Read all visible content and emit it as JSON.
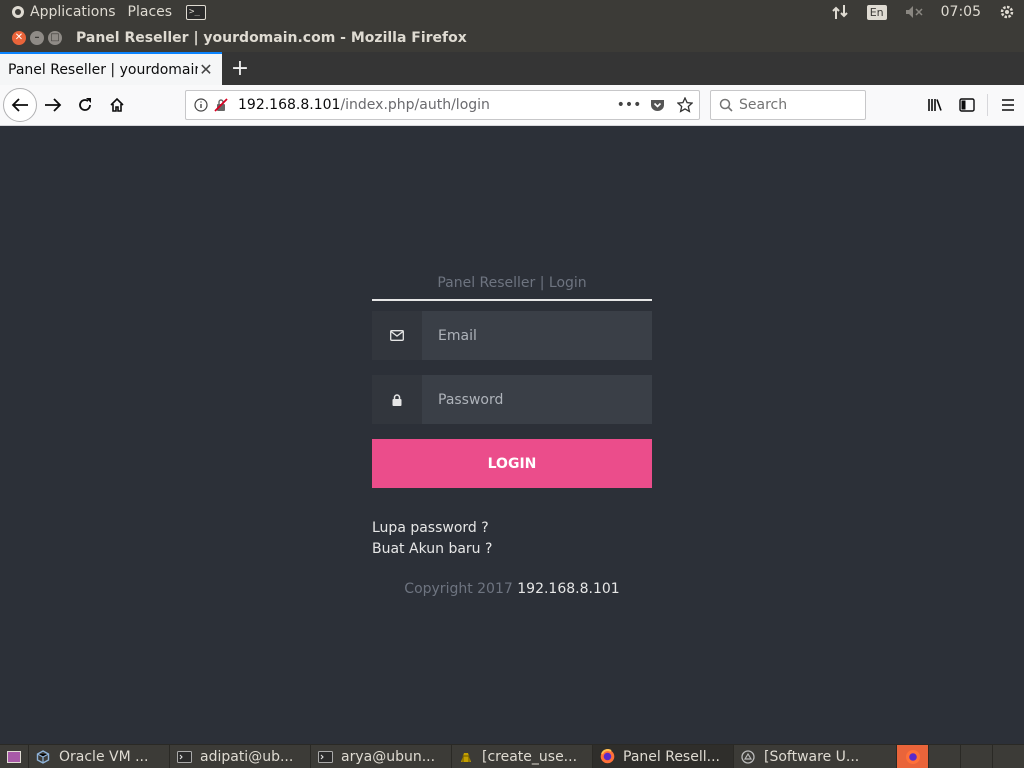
{
  "top_panel": {
    "applications_label": "Applications",
    "places_label": "Places",
    "lang": "En",
    "time": "07:05"
  },
  "window": {
    "title": "Panel Reseller | yourdomain.com - Mozilla Firefox"
  },
  "browser": {
    "tab_label": "Panel Reseller | yourdomain.com",
    "url_host": "192.168.8.101",
    "url_path": "/index.php/auth/login",
    "search_placeholder": "Search"
  },
  "login": {
    "heading": "Panel Reseller | Login",
    "email_placeholder": "Email",
    "password_placeholder": "Password",
    "login_button": "LOGIN",
    "forgot_link": "Lupa password ?",
    "register_link": "Buat Akun baru ?",
    "copyright_prefix": "Copyright 2017",
    "copyright_host": "192.168.8.101"
  },
  "taskbar": {
    "tasks": [
      {
        "label": "Oracle VM ...",
        "icon": "virtualbox-icon"
      },
      {
        "label": "adipati@ub...",
        "icon": "terminal-icon"
      },
      {
        "label": "arya@ubun...",
        "icon": "terminal-icon"
      },
      {
        "label": "[create_use...",
        "icon": "gedit-icon"
      },
      {
        "label": "Panel Resell...",
        "icon": "firefox-icon"
      },
      {
        "label": "[Software U...",
        "icon": "software-updater-icon"
      }
    ]
  }
}
